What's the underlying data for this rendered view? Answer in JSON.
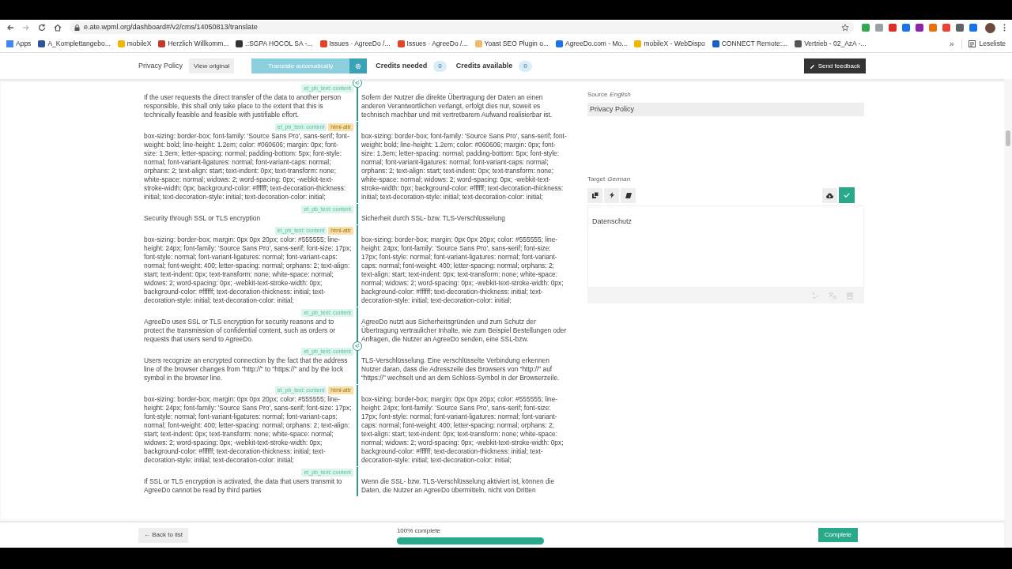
{
  "browser": {
    "url": "e.ate.wpml.org/dashboard#/v2/cms/14050813/translate",
    "bookmarks": [
      "Apps",
      "A_Komplettangebo...",
      "mobileX",
      "Herzlich Willkomm...",
      ".:SGPA HOCOL SA -...",
      "Issues · AgreeDo /...",
      "Issues · AgreeDo /...",
      "Yoast SEO Plugin o...",
      "AgreeDo.com - Mo...",
      "mobileX - WebDispo",
      "CONNECT Remote:...",
      "Vertrieb - 02_AzA -..."
    ],
    "more": "»",
    "reading_list": "Leseliste"
  },
  "toolbar": {
    "title": "Privacy Policy",
    "view_original": "View original",
    "translate_button": {
      "label": "Translate automatically",
      "disabled": true
    },
    "credits_needed_label": "Credits needed",
    "credits_needed": "0",
    "credits_available_label": "Credits available",
    "credits_available": "0",
    "feedback_button": "Send feedback"
  },
  "segments": [
    {
      "linked": true,
      "source": "If the user requests the direct transfer of the data to another person responsible, this shall only take place to the extent that this is technically feasible and feasible with justifiable effort.",
      "tags": [
        {
          "label": "et_pb_text: content",
          "kind": "content"
        }
      ],
      "target": "Sofern der Nutzer die direkte Übertragung der Daten an einen anderen Verantwortlichen verlangt, erfolgt dies nur, soweit es technisch machbar und mit vertretbarem Aufwand realisierbar ist."
    },
    {
      "linked": false,
      "source": "box-sizing: border-box; font-family: 'Source Sans Pro', sans-serif; font-weight: bold; line-height: 1.2em; color: #060606; margin: 0px; font-size: 1.3em; letter-spacing: normal; padding-bottom: 5px; font-style: normal; font-variant-ligatures: normal; font-variant-caps: normal; orphans: 2; text-align: start; text-indent: 0px; text-transform: none; white-space: normal; widows: 2; word-spacing: 0px; -webkit-text-stroke-width: 0px; background-color: #ffffff; text-decoration-thickness: initial; text-decoration-style: initial; text-decoration-color: initial;",
      "tags": [
        {
          "label": "et_pb_text: content",
          "kind": "content"
        },
        {
          "label": "html-attr",
          "kind": "attr"
        }
      ],
      "target": "box-sizing: border-box; font-family: 'Source Sans Pro', sans-serif; font-weight: bold; line-height: 1.2em; color: #060606; margin: 0px; font-size: 1.3em; letter-spacing: normal; padding-bottom: 5px; font-style: normal; font-variant-ligatures: normal; font-variant-caps: normal; orphans: 2; text-align: start; text-indent: 0px; text-transform: none; white-space: normal; widows: 2; word-spacing: 0px; -webkit-text-stroke-width: 0px; background-color: #ffffff; text-decoration-thickness: initial; text-decoration-style: initial; text-decoration-color: initial;"
    },
    {
      "linked": false,
      "source": "Security through SSL or TLS encryption",
      "tags": [
        {
          "label": "et_pb_text: content",
          "kind": "content"
        }
      ],
      "target": "Sicherheit durch SSL- bzw. TLS-Verschlüsselung"
    },
    {
      "linked": false,
      "source": "box-sizing: border-box; margin: 0px 0px 20px; color: #555555; line-height: 24px; font-family: 'Source Sans Pro', sans-serif; font-size: 17px; font-style: normal; font-variant-ligatures: normal; font-variant-caps: normal; font-weight: 400; letter-spacing: normal; orphans: 2; text-align: start; text-indent: 0px; text-transform: none; white-space: normal; widows: 2; word-spacing: 0px; -webkit-text-stroke-width: 0px; background-color: #ffffff; text-decoration-thickness: initial; text-decoration-style: initial; text-decoration-color: initial;",
      "tags": [
        {
          "label": "et_pb_text: content",
          "kind": "content"
        },
        {
          "label": "html-attr",
          "kind": "attr"
        }
      ],
      "target": "box-sizing: border-box; margin: 0px 0px 20px; color: #555555; line-height: 24px; font-family: 'Source Sans Pro', sans-serif; font-size: 17px; font-style: normal; font-variant-ligatures: normal; font-variant-caps: normal; font-weight: 400; letter-spacing: normal; orphans: 2; text-align: start; text-indent: 0px; text-transform: none; white-space: normal; widows: 2; word-spacing: 0px; -webkit-text-stroke-width: 0px; background-color: #ffffff; text-decoration-thickness: initial; text-decoration-style: initial; text-decoration-color: initial;"
    },
    {
      "linked": false,
      "source": "AgreeDo uses SSL or TLS encryption for security reasons and to protect the transmission of confidential content, such as orders or requests that users send to AgreeDo.",
      "tags": [
        {
          "label": "et_pb_text: content",
          "kind": "content"
        }
      ],
      "target": "AgreeDo nutzt aus Sicherheitsgründen und zum Schutz der Übertragung vertraulicher Inhalte, wie zum Beispiel Bestellungen oder Anfragen, die Nutzer an AgreeDo senden, eine SSL-bzw."
    },
    {
      "linked": true,
      "source": "Users recognize an encrypted connection by the fact that the address line of the browser changes from \"http://\" to \"https://\" and by the lock symbol in the browser line.",
      "tags": [
        {
          "label": "et_pb_text: content",
          "kind": "content"
        }
      ],
      "target": "TLS-Verschlüsselung. Eine verschlüsselte Verbindung erkennen Nutzer daran, dass die Adresszeile des Browsers von “http://” auf “https://” wechselt und an dem Schloss-Symbol in der Browserzeile."
    },
    {
      "linked": false,
      "source": "box-sizing: border-box; margin: 0px 0px 20px; color: #555555; line-height: 24px; font-family: 'Source Sans Pro', sans-serif; font-size: 17px; font-style: normal; font-variant-ligatures: normal; font-variant-caps: normal; font-weight: 400; letter-spacing: normal; orphans: 2; text-align: start; text-indent: 0px; text-transform: none; white-space: normal; widows: 2; word-spacing: 0px; -webkit-text-stroke-width: 0px; background-color: #ffffff; text-decoration-thickness: initial; text-decoration-style: initial; text-decoration-color: initial;",
      "tags": [
        {
          "label": "et_pb_text: content",
          "kind": "content"
        },
        {
          "label": "html-attr",
          "kind": "attr"
        }
      ],
      "target": "box-sizing: border-box; margin: 0px 0px 20px; color: #555555; line-height: 24px; font-family: 'Source Sans Pro', sans-serif; font-size: 17px; font-style: normal; font-variant-ligatures: normal; font-variant-caps: normal; font-weight: 400; letter-spacing: normal; orphans: 2; text-align: start; text-indent: 0px; text-transform: none; white-space: normal; widows: 2; word-spacing: 0px; -webkit-text-stroke-width: 0px; background-color: #ffffff; text-decoration-thickness: initial; text-decoration-style: initial; text-decoration-color: initial;"
    },
    {
      "linked": false,
      "source": "If SSL or TLS encryption is activated, the data that users transmit to AgreeDo cannot be read by third parties",
      "tags": [
        {
          "label": "et_pb_text: content",
          "kind": "content"
        }
      ],
      "target": "Wenn die SSL- bzw. TLS-Verschlüsselung aktiviert ist, können die Daten, die Nutzer an AgreeDo übermitteln, nicht von Dritten"
    }
  ],
  "panel": {
    "source_label": "Source",
    "source_language": "English",
    "source_text": "Privacy Policy",
    "target_label": "Target",
    "target_language": "German",
    "target_text": "Datenschutz"
  },
  "footer": {
    "back_button": "← Back to list",
    "progress_label": "100% complete",
    "progress": {
      "level": 1
    },
    "complete_button": "Complete"
  }
}
